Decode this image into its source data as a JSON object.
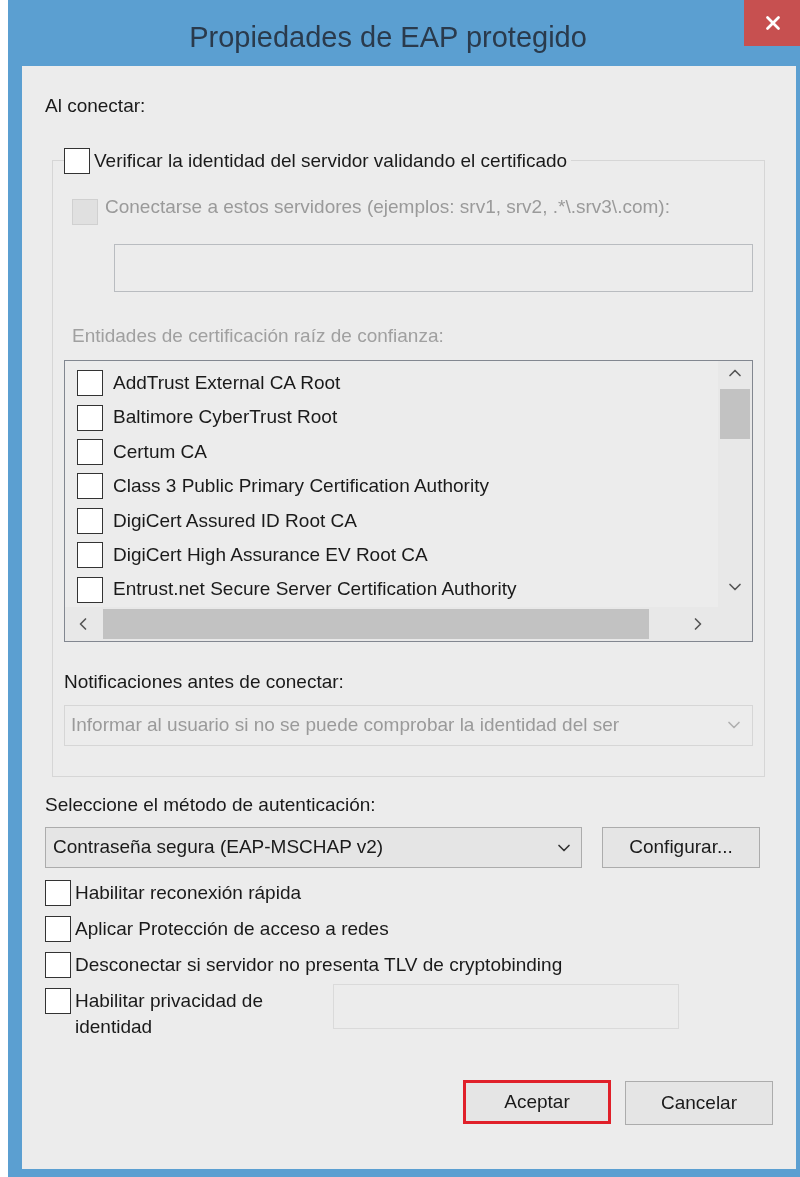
{
  "window": {
    "title": "Propiedades de EAP protegido"
  },
  "connect_label": "Al conectar:",
  "verify_server": {
    "label": "Verificar la identidad del servidor validando el certificado",
    "checked": false
  },
  "servers": {
    "label": "Conectarse a estos servidores (ejemplos: srv1, srv2, .*\\.srv3\\.com):",
    "checked": false,
    "disabled": true
  },
  "root_ca": {
    "label": "Entidades de certificación raíz de confianza:",
    "disabled": true,
    "items": [
      {
        "label": "AddTrust External CA Root",
        "checked": false
      },
      {
        "label": "Baltimore CyberTrust Root",
        "checked": false
      },
      {
        "label": "Certum CA",
        "checked": false
      },
      {
        "label": "Class 3 Public Primary Certification Authority",
        "checked": false
      },
      {
        "label": "DigiCert Assured ID Root CA",
        "checked": false
      },
      {
        "label": "DigiCert High Assurance EV Root CA",
        "checked": false
      },
      {
        "label": "Entrust.net Secure Server Certification Authority",
        "checked": false
      }
    ]
  },
  "notifications": {
    "label": "Notificaciones antes de conectar:",
    "value": "Informar al usuario si no se puede comprobar la identidad del ser",
    "disabled": true
  },
  "auth": {
    "label": "Seleccione el método de autenticación:",
    "method": "Contraseña segura (EAP-MSCHAP v2)",
    "configure": "Configurar..."
  },
  "options": [
    {
      "kind": "plain",
      "label": "Habilitar reconexión rápida",
      "checked": false
    },
    {
      "kind": "plain",
      "label": "Aplicar Protección de acceso a redes",
      "checked": false
    },
    {
      "kind": "plain",
      "label": "Desconectar si servidor no presenta TLV de cryptobinding",
      "checked": false
    },
    {
      "kind": "with_field",
      "label": "Habilitar privacidad de identidad",
      "checked": false
    }
  ],
  "buttons": [
    {
      "label": "Aceptar",
      "highlighted": true
    },
    {
      "label": "Cancelar",
      "highlighted": false
    }
  ]
}
